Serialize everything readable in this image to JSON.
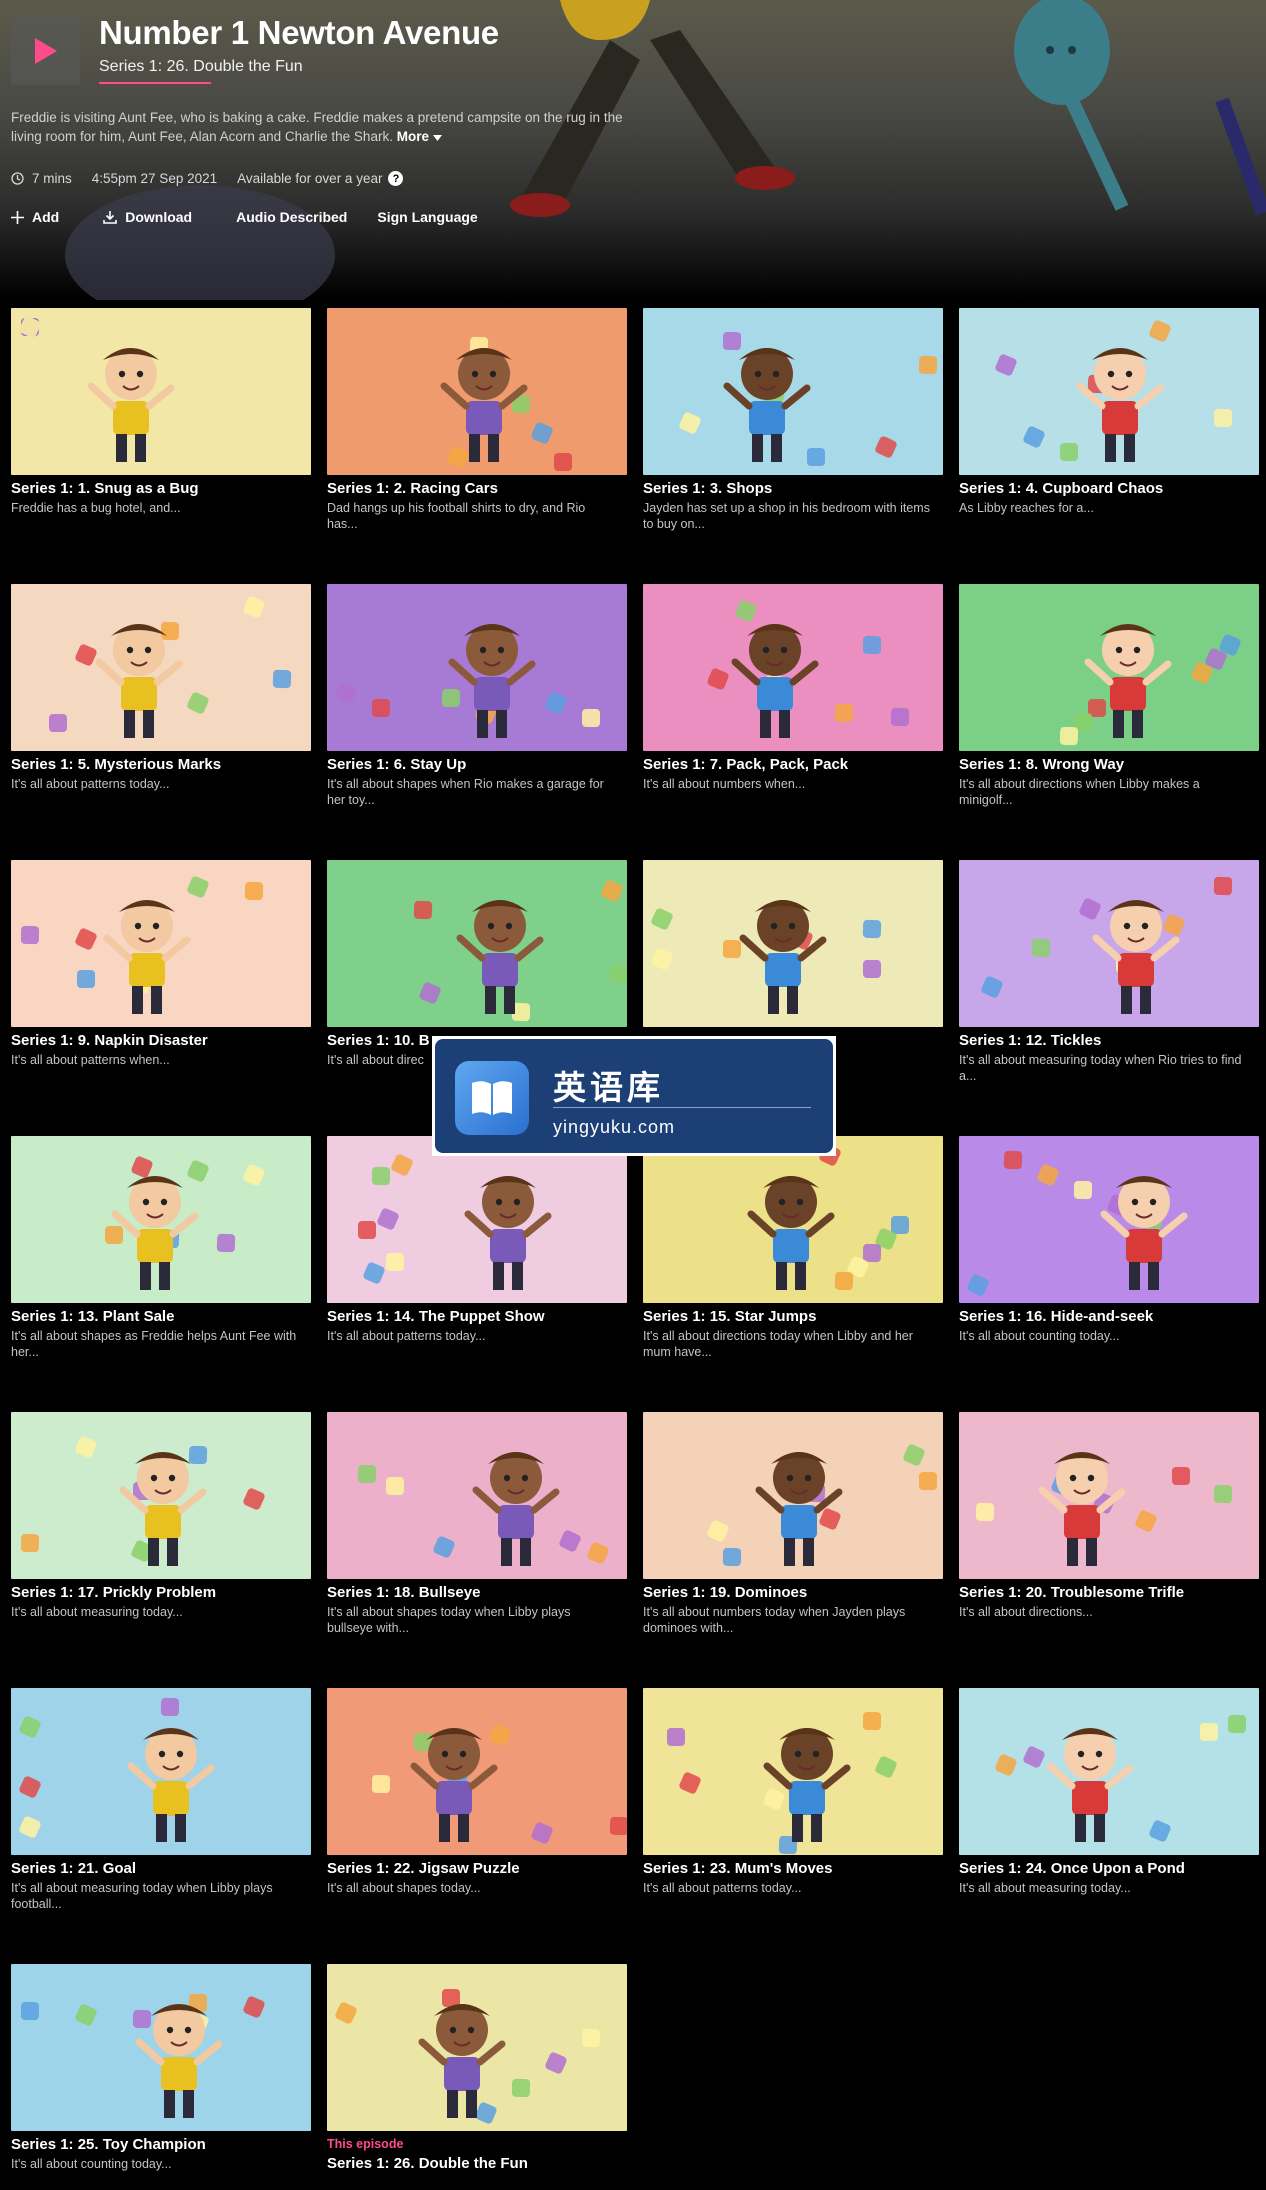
{
  "hero": {
    "title": "Number 1 Newton Avenue",
    "subtitle": "Series 1: 26. Double the Fun",
    "description": "Freddie is visiting Aunt Fee, who is baking a cake. Freddie makes a pretend campsite on the rug in the living room for him, Aunt Fee, Alan Acorn and Charlie the Shark.",
    "more_label": "More",
    "play_icon": "play-icon",
    "accent_color": "#ff4b8b"
  },
  "meta": {
    "duration": "7 mins",
    "broadcast": "4:55pm 27 Sep 2021",
    "availability": "Available for over a year"
  },
  "actions": {
    "add": "Add",
    "download": "Download",
    "audio_described": "Audio Described",
    "sign_language": "Sign Language"
  },
  "episodes": [
    {
      "title": "Series 1: 1. Snug as a Bug",
      "desc": "Freddie has a bug hotel, and...",
      "bg": "#f2e7a6"
    },
    {
      "title": "Series 1: 2. Racing Cars",
      "desc": "Dad hangs up his football shirts to dry, and Rio has...",
      "bg": "#ef9b6e"
    },
    {
      "title": "Series 1: 3. Shops",
      "desc": "Jayden has set up a shop in his bedroom with items to buy on...",
      "bg": "#a8d9e8"
    },
    {
      "title": "Series 1: 4. Cupboard Chaos",
      "desc": "As Libby reaches for a...",
      "bg": "#b6dfe8"
    },
    {
      "title": "Series 1: 5. Mysterious Marks",
      "desc": "It's all about patterns today...",
      "bg": "#f4d8c0"
    },
    {
      "title": "Series 1: 6. Stay Up",
      "desc": "It's all about shapes when Rio makes a garage for her toy...",
      "bg": "#a77ad6"
    },
    {
      "title": "Series 1: 7. Pack, Pack, Pack",
      "desc": "It's all about numbers when...",
      "bg": "#ea8fc0"
    },
    {
      "title": "Series 1: 8. Wrong Way",
      "desc": "It's all about directions when Libby makes a minigolf...",
      "bg": "#7ccf86"
    },
    {
      "title": "Series 1: 9. Napkin Disaster",
      "desc": "It's all about patterns when...",
      "bg": "#f8d6c2"
    },
    {
      "title": "Series 1: 10. B",
      "desc": "It's all about direc",
      "bg": "#7fd08a"
    },
    {
      "title": "",
      "desc": "",
      "bg": "#eeeab8"
    },
    {
      "title": "Series 1: 12. Tickles",
      "desc": "It's all about measuring today when Rio tries to find a...",
      "bg": "#c8a6ea"
    },
    {
      "title": "Series 1: 13. Plant Sale",
      "desc": "It's all about shapes as Freddie helps Aunt Fee with her...",
      "bg": "#c8ebc8"
    },
    {
      "title": "Series 1: 14. The Puppet Show",
      "desc": "It's all about patterns today...",
      "bg": "#f0cce0"
    },
    {
      "title": "Series 1: 15. Star Jumps",
      "desc": "It's all about directions today when Libby and her mum have...",
      "bg": "#ece089"
    },
    {
      "title": "Series 1: 16. Hide-and-seek",
      "desc": "It's all about counting today...",
      "bg": "#b98ae8"
    },
    {
      "title": "Series 1: 17. Prickly Problem",
      "desc": "It's all about measuring today...",
      "bg": "#cdeccd"
    },
    {
      "title": "Series 1: 18. Bullseye",
      "desc": "It's all about shapes today when Libby plays bullseye with...",
      "bg": "#ecb0ca"
    },
    {
      "title": "Series 1: 19. Dominoes",
      "desc": "It's all about numbers today when Jayden plays dominoes with...",
      "bg": "#f4d2b8"
    },
    {
      "title": "Series 1: 20. Troublesome Trifle",
      "desc": "It's all about directions...",
      "bg": "#eeb8cc"
    },
    {
      "title": "Series 1: 21. Goal",
      "desc": "It's all about measuring today when Libby plays football...",
      "bg": "#9ed3ea"
    },
    {
      "title": "Series 1: 22. Jigsaw Puzzle",
      "desc": "It's all about shapes today...",
      "bg": "#f09a78"
    },
    {
      "title": "Series 1: 23. Mum's Moves",
      "desc": "It's all about patterns today...",
      "bg": "#f0e498"
    },
    {
      "title": "Series 1: 24. Once Upon a Pond",
      "desc": "It's all about measuring today...",
      "bg": "#b4e0e8"
    },
    {
      "title": "Series 1: 25. Toy Champion",
      "desc": "It's all about counting today...",
      "bg": "#9ed4ea"
    },
    {
      "title": "Series 1: 26. Double the Fun",
      "desc": "",
      "tag": "This episode",
      "bg": "#ebe6a6"
    }
  ],
  "watermark": {
    "name": "英语库",
    "url": "yingyuku.com"
  }
}
